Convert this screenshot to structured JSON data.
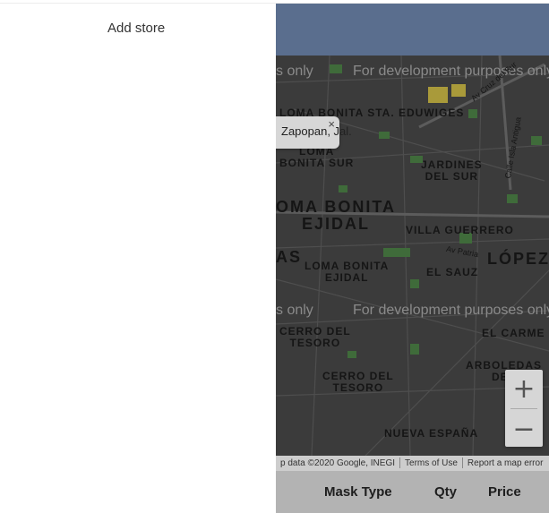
{
  "panel": {
    "add_store_label": "Add store"
  },
  "map": {
    "watermarks": [
      "s only",
      "For development purposes only",
      "s only",
      "For development purposes only"
    ],
    "labels": {
      "loma_bonita_sta_eduwiges": "LOMA BONITA STA. EDUWIGES",
      "loma": "LOMA",
      "bonita_sur": "BONITA SUR",
      "jardines_del_sur": "JARDINES\nDEL SUR",
      "loma_bonita_ejidal_big": "OMA BONITA\nEJIDAL",
      "villa_guerrero": "VILLA GUERRERO",
      "as": "AS",
      "loma_bonita_ejidal_small": "LOMA BONITA\nEJIDAL",
      "el_sauz": "EL SAUZ",
      "lopez": "LÓPEZ",
      "cerro_del_tesoro_1": "CERRO DEL\nTESORO",
      "el_carme": "EL CARME",
      "cerro_del_tesoro_2": "CERRO DEL\nTESORO",
      "arboledas_del": "ARBOLEDAS\nDEL",
      "nueva_espana": "NUEVA ESPAÑA",
      "av_cruz_del_sur": "Av Cruz del Sur",
      "calle_isla_antigua": "Calle Isla Antigua",
      "av_patria": "Av Patria"
    },
    "info_window": {
      "text": "Zapopan, Jal.",
      "close": "×"
    },
    "zoom": {
      "in": "+",
      "out": "−"
    },
    "attribution": {
      "data": "p data ©2020 Google, INEGI",
      "terms": "Terms of Use",
      "report": "Report a map error"
    },
    "colors": {
      "header": "#5a6e8e",
      "map_bg": "#3b3b3b",
      "park": "#3f6b3a"
    }
  },
  "table": {
    "columns": [
      "Mask Type",
      "Qty",
      "Price"
    ]
  }
}
